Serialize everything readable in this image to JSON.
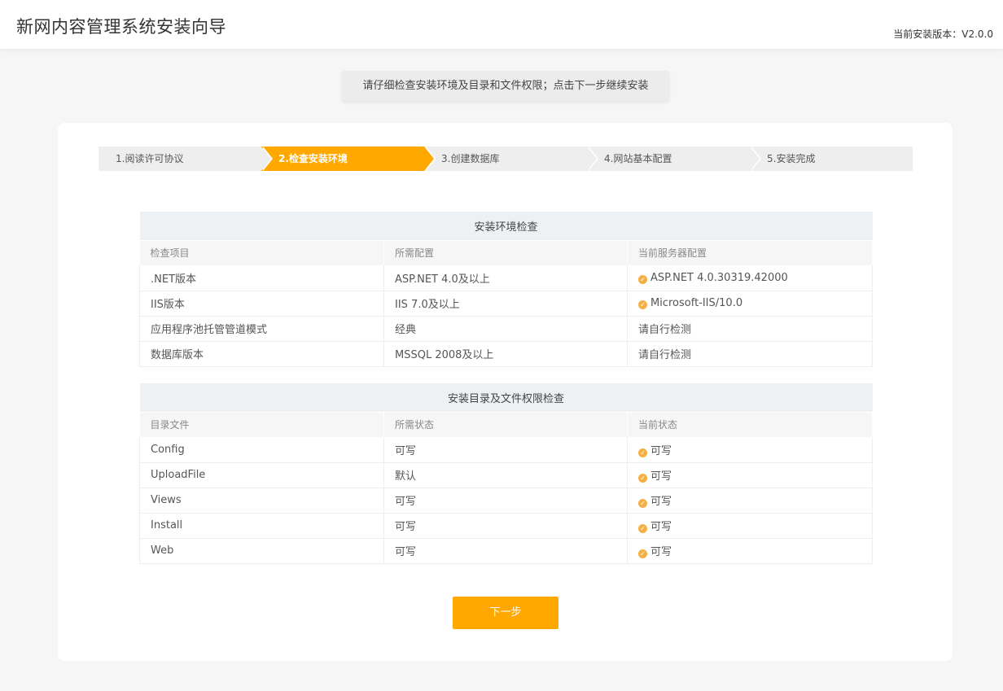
{
  "header": {
    "title": "新网内容管理系统安装向导",
    "version": "当前安装版本：V2.0.0"
  },
  "notice": "请仔细检查安装环境及目录和文件权限；点击下一步继续安装",
  "steps": [
    {
      "label": "1.阅读许可协议",
      "active": false
    },
    {
      "label": "2.检查安装环境",
      "active": true
    },
    {
      "label": "3.创建数据库",
      "active": false
    },
    {
      "label": "4.网站基本配置",
      "active": false
    },
    {
      "label": "5.安装完成",
      "active": false
    }
  ],
  "env_check": {
    "caption": "安装环境检查",
    "columns": [
      "检查项目",
      "所需配置",
      "当前服务器配置"
    ],
    "rows": [
      {
        "item": ".NET版本",
        "required": "ASP.NET 4.0及以上",
        "current": "ASP.NET 4.0.30319.42000",
        "ok": true
      },
      {
        "item": "IIS版本",
        "required": "IIS 7.0及以上",
        "current": "Microsoft-IIS/10.0",
        "ok": true
      },
      {
        "item": "应用程序池托管管道模式",
        "required": "经典",
        "current": "请自行检测",
        "ok": false
      },
      {
        "item": "数据库版本",
        "required": "MSSQL 2008及以上",
        "current": "请自行检测",
        "ok": false
      }
    ]
  },
  "dir_check": {
    "caption": "安装目录及文件权限检查",
    "columns": [
      "目录文件",
      "所需状态",
      "当前状态"
    ],
    "rows": [
      {
        "item": "Config",
        "required": "可写",
        "current": "可写",
        "ok": true
      },
      {
        "item": "UploadFile",
        "required": "默认",
        "current": "可写",
        "ok": true
      },
      {
        "item": "Views",
        "required": "可写",
        "current": "可写",
        "ok": true
      },
      {
        "item": "Install",
        "required": "可写",
        "current": "可写",
        "ok": true
      },
      {
        "item": "Web",
        "required": "可写",
        "current": "可写",
        "ok": true
      }
    ]
  },
  "next_button": "下一步",
  "colors": {
    "accent": "#ffa800",
    "ok_icon": "#f5b045"
  },
  "icons": {
    "ok": "check-circle-icon"
  }
}
